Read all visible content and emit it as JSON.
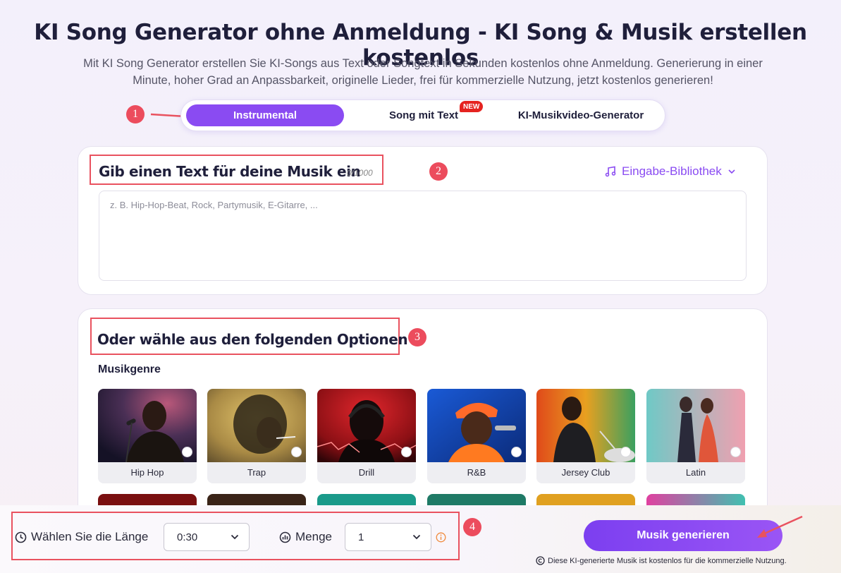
{
  "page": {
    "title": "KI Song Generator ohne Anmeldung - KI Song & Musik erstellen kostenlos",
    "subtitle": "Mit KI Song Generator erstellen Sie KI-Songs aus Text oder Songtext in Sekunden kostenlos ohne Anmeldung. Generierung in einer Minute, hoher Grad an Anpassbarkeit, originelle Lieder, frei für kommerzielle Nutzung, jetzt kostenlos generieren!"
  },
  "annotations": [
    "1",
    "2",
    "3",
    "4"
  ],
  "tabs": [
    {
      "label": "Instrumental",
      "active": true
    },
    {
      "label": "Song mit Text",
      "badge": "NEW"
    },
    {
      "label": "KI-Musikvideo-Generator"
    }
  ],
  "text_input": {
    "heading": "Gib einen Text für deine Musik ein",
    "counter": "0/1000",
    "library_label": "Eingabe-Bibliothek",
    "placeholder": "z. B. Hip-Hop-Beat, Rock, Partymusik, E-Gitarre, ...",
    "value": ""
  },
  "options": {
    "heading": "Oder wähle aus den folgenden Optionen",
    "genre_label": "Musikgenre",
    "genres": [
      {
        "name": "Hip Hop"
      },
      {
        "name": "Trap"
      },
      {
        "name": "Drill"
      },
      {
        "name": "R&B"
      },
      {
        "name": "Jersey Club"
      },
      {
        "name": "Latin"
      }
    ]
  },
  "bottom": {
    "length_label": "Wählen Sie die Länge",
    "length_value": "0:30",
    "amount_label": "Menge",
    "amount_value": "1",
    "generate_label": "Musik generieren",
    "footnote": "Diese KI-generierte Musik ist kostenlos für die kommerzielle Nutzung."
  },
  "colors": {
    "accent": "#8a4bf2",
    "annotation_red": "#e9525f",
    "new_badge": "#e52320"
  }
}
